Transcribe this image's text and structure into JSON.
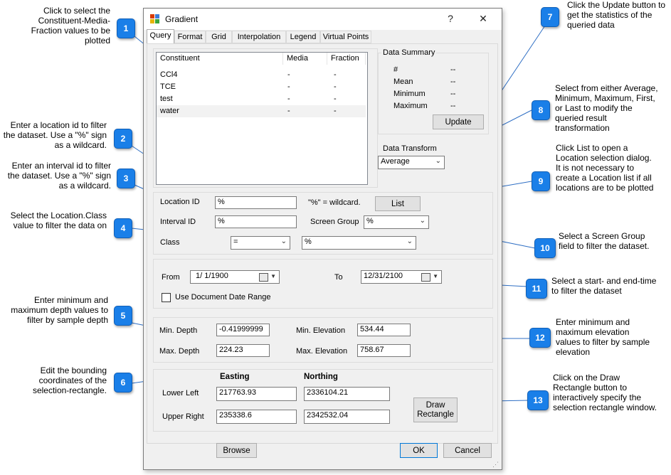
{
  "window": {
    "title": "Gradient",
    "help_glyph": "?",
    "close_glyph": "✕",
    "app_icon": "gradient-app-icon"
  },
  "tabs": [
    {
      "label": "Query",
      "active": true
    },
    {
      "label": "Format"
    },
    {
      "label": "Grid"
    },
    {
      "label": "Interpolation"
    },
    {
      "label": "Legend"
    },
    {
      "label": "Virtual Points"
    }
  ],
  "constituent_list": {
    "headers": [
      "Constituent",
      "Media",
      "Fraction"
    ],
    "rows": [
      {
        "constituent": "CCl4",
        "media": "-",
        "fraction": "-"
      },
      {
        "constituent": "TCE",
        "media": "-",
        "fraction": "-"
      },
      {
        "constituent": "test",
        "media": "-",
        "fraction": "-"
      },
      {
        "constituent": "water",
        "media": "-",
        "fraction": "-",
        "selected": true
      }
    ]
  },
  "data_summary": {
    "title": "Data Summary",
    "rows": [
      {
        "label": "#",
        "value": "--"
      },
      {
        "label": "Mean",
        "value": "--"
      },
      {
        "label": "Minimum",
        "value": "--"
      },
      {
        "label": "Maximum",
        "value": "--"
      }
    ],
    "update_label": "Update"
  },
  "data_transform": {
    "label": "Data Transform",
    "value": "Average"
  },
  "filters": {
    "location_id_label": "Location ID",
    "location_id_value": "%",
    "wildcard_hint": "\"%\" = wildcard.",
    "list_label": "List",
    "interval_id_label": "Interval ID",
    "interval_id_value": "%",
    "screen_group_label": "Screen Group",
    "screen_group_value": "%",
    "class_label": "Class",
    "class_operator": "=",
    "class_value": "%"
  },
  "dates": {
    "from_label": "From",
    "from_value": "1/ 1/1900",
    "to_label": "To",
    "to_value": "12/31/2100",
    "use_doc_range_label": "Use Document Date Range"
  },
  "depth": {
    "min_depth_label": "Min. Depth",
    "min_depth_value": "-0.41999999",
    "max_depth_label": "Max. Depth",
    "max_depth_value": "224.23",
    "min_elev_label": "Min. Elevation",
    "min_elev_value": "534.44",
    "max_elev_label": "Max. Elevation",
    "max_elev_value": "758.67"
  },
  "coords": {
    "easting_header": "Easting",
    "northing_header": "Northing",
    "lower_left_label": "Lower Left",
    "lower_left_easting": "217763.93",
    "lower_left_northing": "2336104.21",
    "upper_right_label": "Upper Right",
    "upper_right_easting": "235338.6",
    "upper_right_northing": "2342532.04",
    "draw_rect_line1": "Draw",
    "draw_rect_line2": "Rectangle"
  },
  "footer": {
    "browse_label": "Browse",
    "ok_label": "OK",
    "cancel_label": "Cancel"
  },
  "callouts": [
    {
      "num": "1",
      "text": "Click to select the Constituent-Media-Fraction values to be plotted"
    },
    {
      "num": "2",
      "text": "Enter a location id to filter the dataset.  Use a \"%\" sign as a wildcard."
    },
    {
      "num": "3",
      "text": "Enter an interval id to filter the dataset.  Use a \"%\" sign as a wildcard."
    },
    {
      "num": "4",
      "text": "Select the Location.Class value to filter the data on"
    },
    {
      "num": "5",
      "text": "Enter minimum and maximum depth values to filter by sample depth"
    },
    {
      "num": "6",
      "text": "Edit the bounding coordinates of the selection-rectangle."
    },
    {
      "num": "7",
      "text": "Click the Update button to get the statistics of the queried data"
    },
    {
      "num": "8",
      "text": "Select from either Average, Minimum, Maximum, First, or Last to modify the queried result transformation"
    },
    {
      "num": "9",
      "text": "Click List to open a Location selection dialog.  It is not necessary to create a Location list if all locations are to be plotted"
    },
    {
      "num": "10",
      "text": "Select a Screen Group field to filter the dataset."
    },
    {
      "num": "11",
      "text": "Select a start- and end-time to filter the dataset"
    },
    {
      "num": "12",
      "text": "Enter minimum and maximum elevation values to filter by sample elevation"
    },
    {
      "num": "13",
      "text": "Click on the Draw Rectangle button to interactively specify the selection rectangle window."
    }
  ],
  "colors": {
    "callout_blue": "#1a7fe8",
    "dialog_bg": "#f0f0f0",
    "selected_row": "#f2f2f2"
  }
}
